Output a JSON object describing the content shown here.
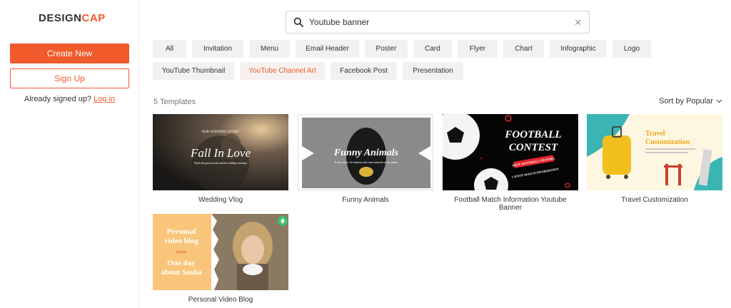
{
  "sidebar": {
    "logo_part1": "DESIGN",
    "logo_part2": "CAP",
    "create_label": "Create New",
    "signup_label": "Sign Up",
    "already_text": "Already signed up?",
    "login_label": "Log in"
  },
  "search": {
    "value": "Youtube banner"
  },
  "categories": [
    "All",
    "Invitation",
    "Menu",
    "Email Header",
    "Poster",
    "Card",
    "Flyer",
    "Chart",
    "Infographic",
    "Logo",
    "YouTube Thumbnail",
    "YouTube Channel Art",
    "Facebook Post",
    "Presentation"
  ],
  "active_category": "YouTube Channel Art",
  "results": {
    "count_label": "5 Templates",
    "sort_label": "Sort by Popular"
  },
  "templates": [
    {
      "title": "Wedding Vlog",
      "thumb_heading": "Fall In Love",
      "thumb_sub": "OUR WEDDING STORY",
      "thumb_small": "Watch the guest arrivals and the wedding ceremony"
    },
    {
      "title": "Funny Animals",
      "thumb_heading": "Funny Animals",
      "thumb_small": "In this video, the funniest and cutest animals on the planet"
    },
    {
      "title": "Football Match Information Youtube Banner",
      "thumb_heading1": "FOOTBALL",
      "thumb_heading2": "CONTEST",
      "thumb_tag1": "BEST FOOTBALL CHANNEL",
      "thumb_tag2": "LATEST MATCH INFORMATION"
    },
    {
      "title": "Travel Customization",
      "thumb_heading1": "Travel",
      "thumb_heading2": "Customization"
    },
    {
      "title": "Personal Video Blog",
      "thumb_l1": "Personal",
      "thumb_l2": "video blog",
      "thumb_l3": "One day",
      "thumb_l4": "about Sasha"
    }
  ],
  "colors": {
    "accent": "#f15a2b"
  }
}
